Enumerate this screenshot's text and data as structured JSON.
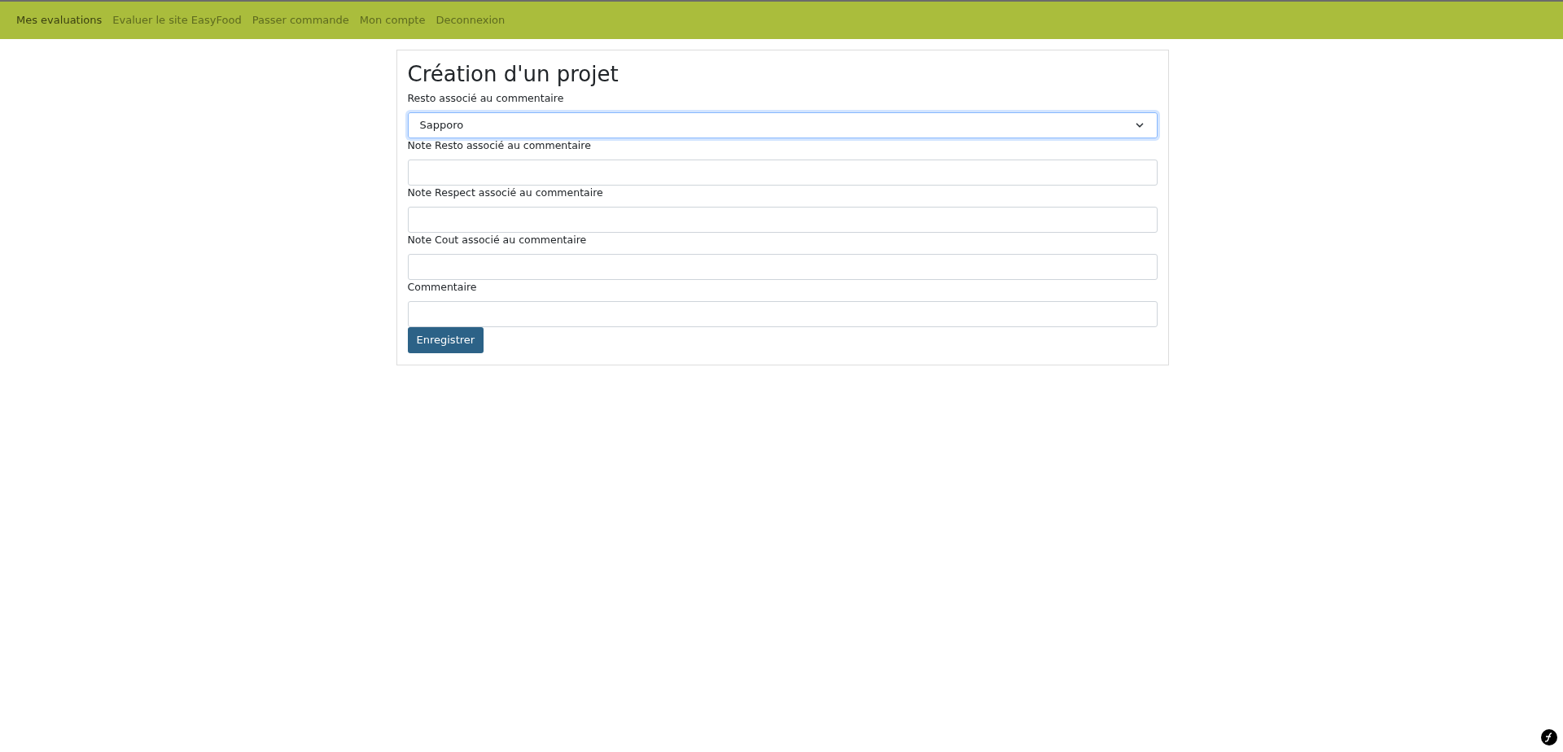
{
  "nav": [
    {
      "label": "Mes evaluations",
      "selected": true
    },
    {
      "label": "Evaluer le site EasyFood",
      "selected": false
    },
    {
      "label": "Passer commande",
      "selected": false
    },
    {
      "label": "Mon compte",
      "selected": false
    },
    {
      "label": "Deconnexion",
      "selected": false
    }
  ],
  "form": {
    "title": "Création d'un projet",
    "fields": [
      {
        "label": "Resto associé au commentaire",
        "kind": "select",
        "value": "Sapporo",
        "focused": true
      },
      {
        "label": "Note Resto associé au commentaire",
        "kind": "text",
        "focused": false
      },
      {
        "label": "Note Respect associé au commentaire",
        "kind": "text",
        "focused": false
      },
      {
        "label": "Note Cout associé au commentaire",
        "kind": "text",
        "focused": false
      },
      {
        "label": "Commentaire",
        "kind": "text",
        "focused": false
      }
    ],
    "submit": "Enregistrer"
  }
}
